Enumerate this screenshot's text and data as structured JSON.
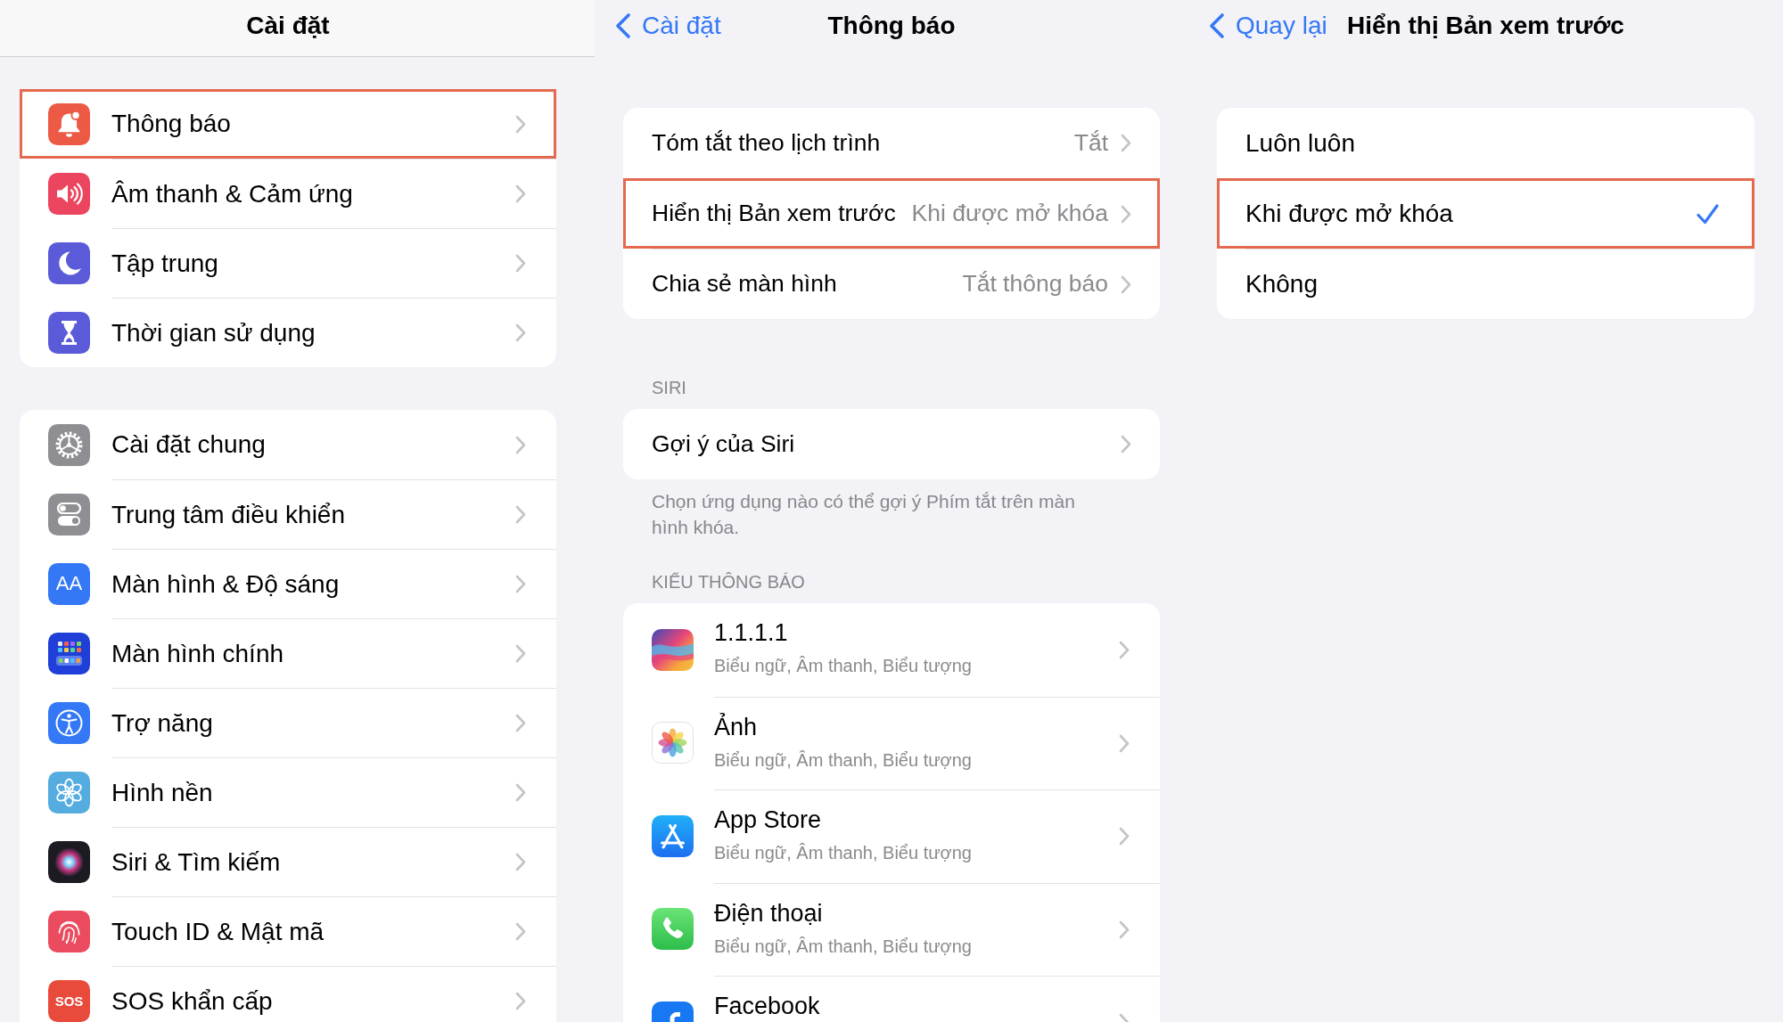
{
  "settings_panel": {
    "title": "Cài đặt",
    "groups": [
      {
        "items": [
          {
            "label": "Thông báo",
            "highlighted": true
          },
          {
            "label": "Âm thanh & Cảm ứng",
            "highlighted": false
          },
          {
            "label": "Tập trung",
            "highlighted": false
          },
          {
            "label": "Thời gian sử dụng",
            "highlighted": false
          }
        ]
      },
      {
        "items": [
          {
            "label": "Cài đặt chung",
            "highlighted": false
          },
          {
            "label": "Trung tâm điều khiển",
            "highlighted": false
          },
          {
            "label": "Màn hình & Độ sáng",
            "icon_text": "AA",
            "highlighted": false
          },
          {
            "label": "Màn hình chính",
            "highlighted": false
          },
          {
            "label": "Trợ năng",
            "highlighted": false
          },
          {
            "label": "Hình nền",
            "highlighted": false
          },
          {
            "label": "Siri & Tìm kiếm",
            "highlighted": false
          },
          {
            "label": "Touch ID & Mật mã",
            "highlighted": false
          },
          {
            "label": "SOS khẩn cấp",
            "icon_text": "SOS",
            "highlighted": false
          }
        ]
      }
    ]
  },
  "notifications_panel": {
    "back_label": "Cài đặt",
    "title": "Thông báo",
    "groups": [
      {
        "kind": "text",
        "rows": [
          {
            "label": "Tóm tắt theo lịch trình",
            "value": "Tắt",
            "highlighted": false
          },
          {
            "label": "Hiển thị Bản xem trước",
            "value": "Khi được mở khóa",
            "highlighted": true
          },
          {
            "label": "Chia sẻ màn hình",
            "value": "Tắt thông báo",
            "highlighted": false
          }
        ]
      },
      {
        "kind": "text",
        "header": "SIRI",
        "rows": [
          {
            "label": "Gợi ý của Siri",
            "highlighted": false
          }
        ],
        "footer": "Chọn ứng dụng nào có thể gợi ý Phím tắt trên màn hình khóa."
      },
      {
        "kind": "apps",
        "header": "KIỂU THÔNG BÁO",
        "rows": [
          {
            "label": "1.1.1.1",
            "detail": "Biểu ngữ, Âm thanh, Biểu tượng",
            "highlighted": false
          },
          {
            "label": "Ảnh",
            "detail": "Biểu ngữ, Âm thanh, Biểu tượng",
            "highlighted": false
          },
          {
            "label": "App Store",
            "detail": "Biểu ngữ, Âm thanh, Biểu tượng",
            "highlighted": false
          },
          {
            "label": "Điện thoại",
            "detail": "Biểu ngữ, Âm thanh, Biểu tượng",
            "highlighted": false
          },
          {
            "label": "Facebook",
            "highlighted": false
          }
        ]
      }
    ]
  },
  "preview_panel": {
    "back_label": "Quay lại",
    "title": "Hiển thị Bản xem trước",
    "options": [
      {
        "label": "Luôn luôn",
        "selected": false,
        "highlighted": false
      },
      {
        "label": "Khi được mở khóa",
        "selected": true,
        "highlighted": true
      },
      {
        "label": "Không",
        "selected": false,
        "highlighted": false
      }
    ]
  }
}
